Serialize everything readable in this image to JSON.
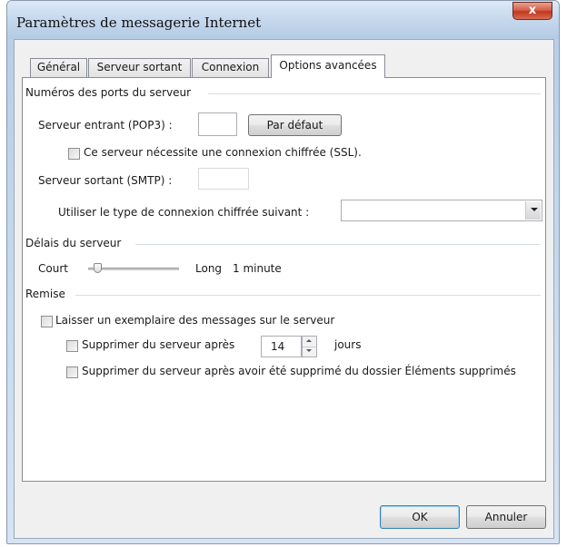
{
  "window": {
    "title": "Paramètres de messagerie Internet",
    "close_glyph": "x"
  },
  "tabs": [
    {
      "label": "Général",
      "active": false
    },
    {
      "label": "Serveur sortant",
      "active": false
    },
    {
      "label": "Connexion",
      "active": false
    },
    {
      "label": "Options avancées",
      "active": true
    }
  ],
  "ports": {
    "group_title": "Numéros des ports du serveur",
    "incoming_label": "Serveur entrant (POP3) :",
    "incoming_value": "",
    "default_button": "Par défaut",
    "ssl_checkbox": {
      "label": "Ce serveur nécessite une connexion chiffrée (SSL).",
      "checked": false
    },
    "outgoing_label": "Serveur sortant (SMTP) :",
    "outgoing_value": "",
    "encryption_label": "Utiliser le type de connexion chiffrée suivant :",
    "encryption_value": ""
  },
  "timeouts": {
    "group_title": "Délais du serveur",
    "short_label": "Court",
    "long_label": "Long",
    "value_text": "1 minute",
    "slider_fraction": 0.1
  },
  "delivery": {
    "group_title": "Remise",
    "leave_copy": {
      "label": "Laisser un exemplaire des messages sur le serveur",
      "checked": false
    },
    "remove_after": {
      "label": "Supprimer du serveur après",
      "checked": false
    },
    "days_value": "14",
    "days_unit": "jours",
    "remove_deleted": {
      "label": "Supprimer du serveur après avoir été supprimé du dossier Éléments supprimés",
      "checked": false
    }
  },
  "footer": {
    "ok_label": "OK",
    "cancel_label": "Annuler"
  },
  "icons": {
    "close": "close-icon",
    "combo_arrow": "chevron-down-icon",
    "spin_up": "spin-up-icon",
    "spin_down": "spin-down-icon"
  }
}
